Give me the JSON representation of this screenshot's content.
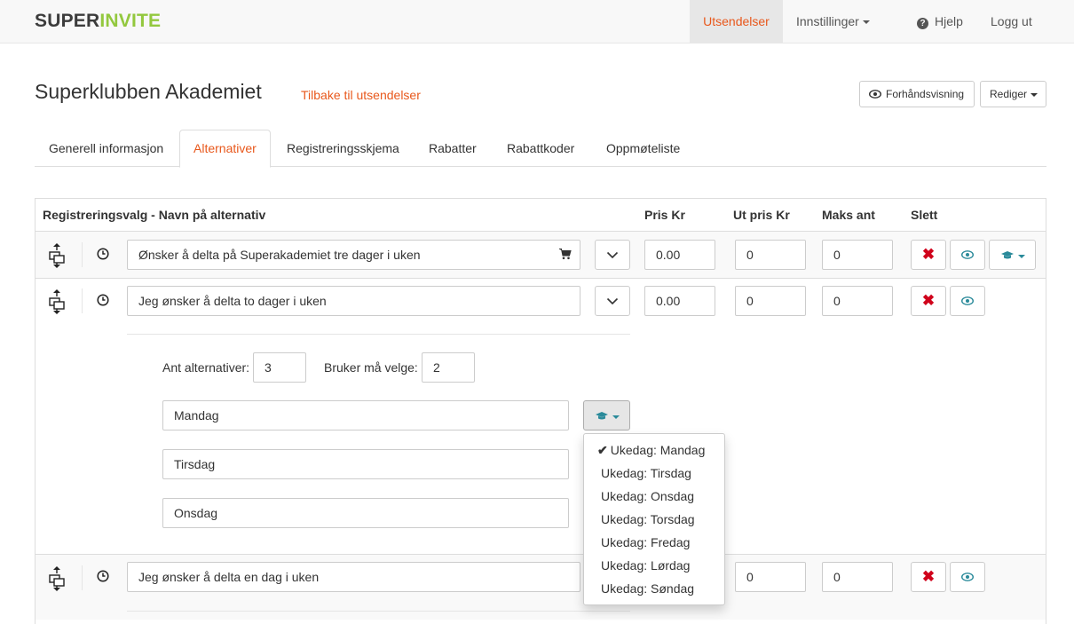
{
  "navbar": {
    "logo_part1": "SUPER",
    "logo_part2": "INVITE",
    "items": [
      {
        "label": "Utsendelser",
        "active": true
      },
      {
        "label": "Innstillinger",
        "dropdown": true
      },
      {
        "label": "Hjelp",
        "icon": "question-circle-icon"
      },
      {
        "label": "Logg ut"
      }
    ]
  },
  "header": {
    "title": "Superklubben Akademiet",
    "back_link": "Tilbake til utsendelser",
    "preview_label": "Forhåndsvisning",
    "edit_label": "Rediger"
  },
  "tabs": [
    {
      "label": "Generell informasjon",
      "active": false
    },
    {
      "label": "Alternativer",
      "active": true
    },
    {
      "label": "Registreringsskjema",
      "active": false
    },
    {
      "label": "Rabatter",
      "active": false
    },
    {
      "label": "Rabattkoder",
      "active": false
    },
    {
      "label": "Oppmøteliste",
      "active": false
    }
  ],
  "table": {
    "headers": [
      "Registreringsvalg - Navn på alternativ",
      "Pris Kr",
      "Ut pris Kr",
      "Maks ant",
      "Slett"
    ],
    "rows": [
      {
        "name": "Ønsker å delta på Superakademiet tre dager i uken",
        "pris": "0.00",
        "ut_pris": "0",
        "maks": "0",
        "cart": true
      },
      {
        "name": "Jeg ønsker å delta to dager i uken",
        "pris": "0.00",
        "ut_pris": "0",
        "maks": "0"
      },
      {
        "name": "Jeg ønsker å delta en dag i uken",
        "pris": "",
        "ut_pris": "0",
        "maks": "0"
      }
    ]
  },
  "sub_options": {
    "count_label": "Ant alternativer:",
    "count_value": "3",
    "must_choose_label": "Bruker må velge:",
    "must_choose_value": "2",
    "items": [
      "Mandag",
      "Tirsdag",
      "Onsdag"
    ]
  },
  "weekday_dropdown": {
    "items": [
      {
        "label": "Ukedag: Mandag",
        "checked": true
      },
      {
        "label": "Ukedag: Tirsdag",
        "checked": false
      },
      {
        "label": "Ukedag: Onsdag",
        "checked": false
      },
      {
        "label": "Ukedag: Torsdag",
        "checked": false
      },
      {
        "label": "Ukedag: Fredag",
        "checked": false
      },
      {
        "label": "Ukedag: Lørdag",
        "checked": false
      },
      {
        "label": "Ukedag: Søndag",
        "checked": false
      }
    ]
  },
  "colors": {
    "accent": "#e8581c",
    "logo_green": "#93c83e",
    "delete_red": "#d0021b",
    "teal_icon": "#2a8a9a"
  }
}
